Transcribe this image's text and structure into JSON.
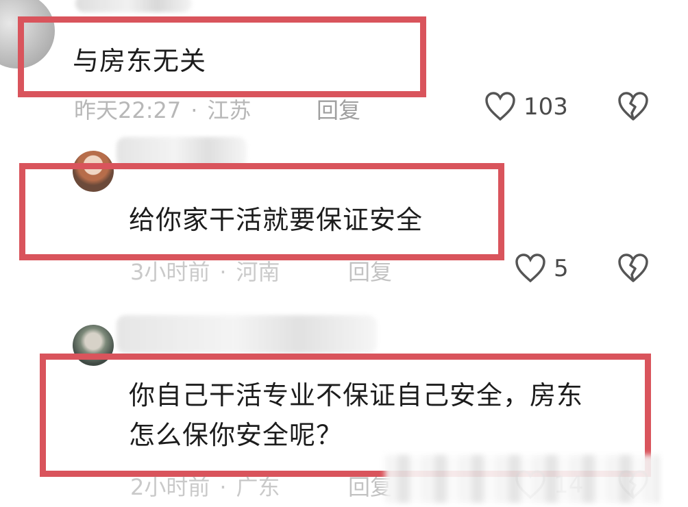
{
  "comments": [
    {
      "text_lines": [
        "与房东无关"
      ],
      "time": "昨天22:27",
      "location": "江苏",
      "reply_label": "回复",
      "like_count": "103"
    },
    {
      "text_lines": [
        "给你家干活就要保证安全"
      ],
      "time": "3小时前",
      "location": "河南",
      "reply_label": "回复",
      "like_count": "5"
    },
    {
      "text_lines": [
        "你自己干活专业不保证自己安全，房东",
        "怎么保你安全呢？"
      ],
      "time": "2小时前",
      "location": "广东",
      "reply_label": "回复",
      "like_count": "14"
    }
  ],
  "colors": {
    "highlight_box": "#d9545c",
    "meta_text": "#b7b7b7",
    "body_text": "#1c1c1c"
  },
  "icons": {
    "like": "heart-outline-icon",
    "dislike": "broken-heart-icon"
  }
}
